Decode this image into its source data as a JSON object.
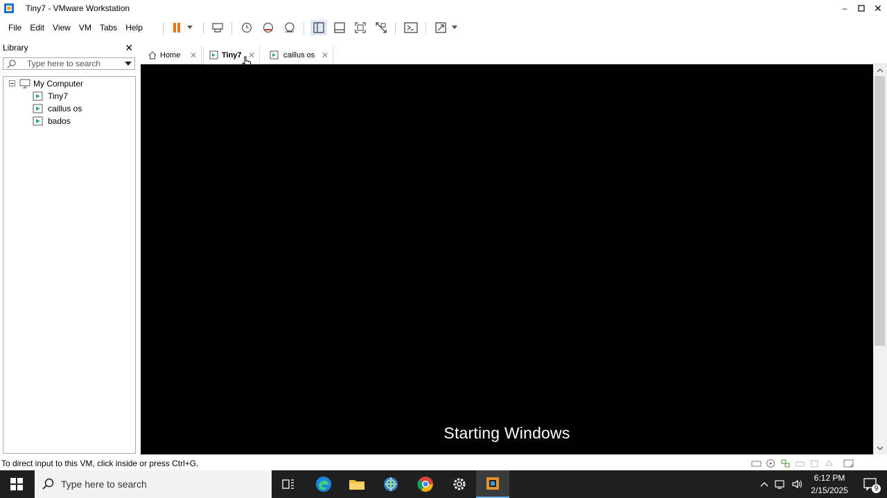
{
  "window": {
    "title": "Tiny7 - VMware Workstation"
  },
  "menu": [
    "File",
    "Edit",
    "View",
    "VM",
    "Tabs",
    "Help"
  ],
  "library": {
    "header": "Library",
    "search_placeholder": "Type here to search",
    "root": "My Computer",
    "vms": [
      "Tiny7",
      "caillus os",
      "bados"
    ]
  },
  "tabs": [
    {
      "label": "Home",
      "active": false
    },
    {
      "label": "Tiny7",
      "active": true
    },
    {
      "label": "caillus os",
      "active": false
    }
  ],
  "console": {
    "boot_text": "Starting Windows"
  },
  "status": {
    "text": "To direct input to this VM, click inside or press Ctrl+G."
  },
  "taskbar": {
    "search_placeholder": "Type here to search",
    "time": "6:12 PM",
    "date": "2/15/2025",
    "notifications": "9"
  }
}
